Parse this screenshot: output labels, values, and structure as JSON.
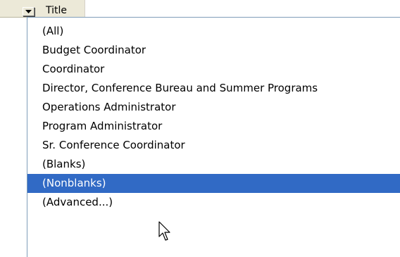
{
  "header": {
    "label": "Title",
    "filter_icon": "dropdown-arrow-icon"
  },
  "dropdown": {
    "items": [
      {
        "label": "(All)",
        "selected": false
      },
      {
        "label": "Budget Coordinator",
        "selected": false
      },
      {
        "label": "Coordinator",
        "selected": false
      },
      {
        "label": "Director, Conference Bureau and Summer Programs",
        "selected": false
      },
      {
        "label": "Operations Administrator",
        "selected": false
      },
      {
        "label": "Program Administrator",
        "selected": false
      },
      {
        "label": "Sr. Conference Coordinator",
        "selected": false
      },
      {
        "label": "(Blanks)",
        "selected": false
      },
      {
        "label": "(Nonblanks)",
        "selected": true
      },
      {
        "label": "(Advanced...)",
        "selected": false
      }
    ],
    "selection_color": "#316ac5"
  },
  "cursor": {
    "icon": "arrow-pointer-icon"
  }
}
